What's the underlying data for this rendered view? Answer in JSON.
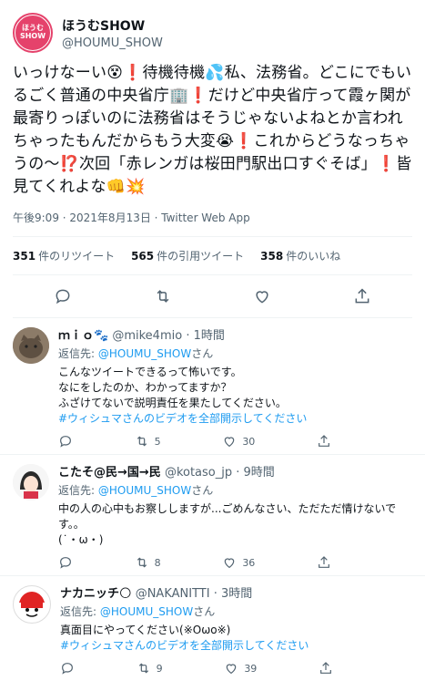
{
  "tweet": {
    "avatar_line1": "ほうむ",
    "avatar_line2": "SHOW",
    "display_name": "ほうむSHOW",
    "handle": "@HOUMU_SHOW",
    "text": "いっけなーい😵❗待機待機💦私、法務省。どこにでもいるごく普通の中央省庁🏢❗だけど中央省庁って霞ヶ関が最寄りっぽいのに法務省はそうじゃないよねとか言われちゃったもんだからもう大変😭❗これからどうなっちゃうの〜⁉️次回「赤レンガは桜田門駅出口すぐそば」❗皆見てくれよな👊💥",
    "meta": "午後9:09 · 2021年8月13日 · Twitter Web App",
    "retweets_num": "351",
    "retweets_label": "件のリツイート",
    "quotes_num": "565",
    "quotes_label": "件の引用ツイート",
    "likes_num": "358",
    "likes_label": "件のいいね"
  },
  "replies": [
    {
      "name": "ｍｉｏ🐾",
      "handle": "@mike4mio",
      "time": "· 1時間",
      "to_prefix": "返信先: ",
      "to_mention": "@HOUMU_SHOW",
      "to_suffix": "さん",
      "line1": "こんなツイートできるって怖いです。",
      "line2": "なにをしたのか、わかってますか？",
      "line3": "ふざけてないで説明責任を果たしてください。",
      "hashtag": "#ウィシュマさんのビデオを全部開示してください",
      "retweets": "5",
      "likes": "30"
    },
    {
      "name": "こたそ@民→国→民",
      "handle": "@kotaso_jp",
      "time": "· 9時間",
      "to_prefix": "返信先: ",
      "to_mention": "@HOUMU_SHOW",
      "to_suffix": "さん",
      "line1": "中の人の心中もお察ししますが...ごめんなさい、ただただ情けないです。。",
      "line2": "(˙・ω・)",
      "retweets": "8",
      "likes": "36"
    },
    {
      "name": "ナカニッチ🌕",
      "handle": "@NAKANITTI",
      "time": "· 3時間",
      "to_prefix": "返信先: ",
      "to_mention": "@HOUMU_SHOW",
      "to_suffix": "さん",
      "line1": "真面目にやってください(※Oωo※)",
      "hashtag": "#ウィシュマさんのビデオを全部開示してください",
      "retweets": "9",
      "likes": "39"
    }
  ],
  "colors": {
    "accent": "#1d9bf0",
    "muted": "#536471",
    "avatar": "#e5426b"
  }
}
